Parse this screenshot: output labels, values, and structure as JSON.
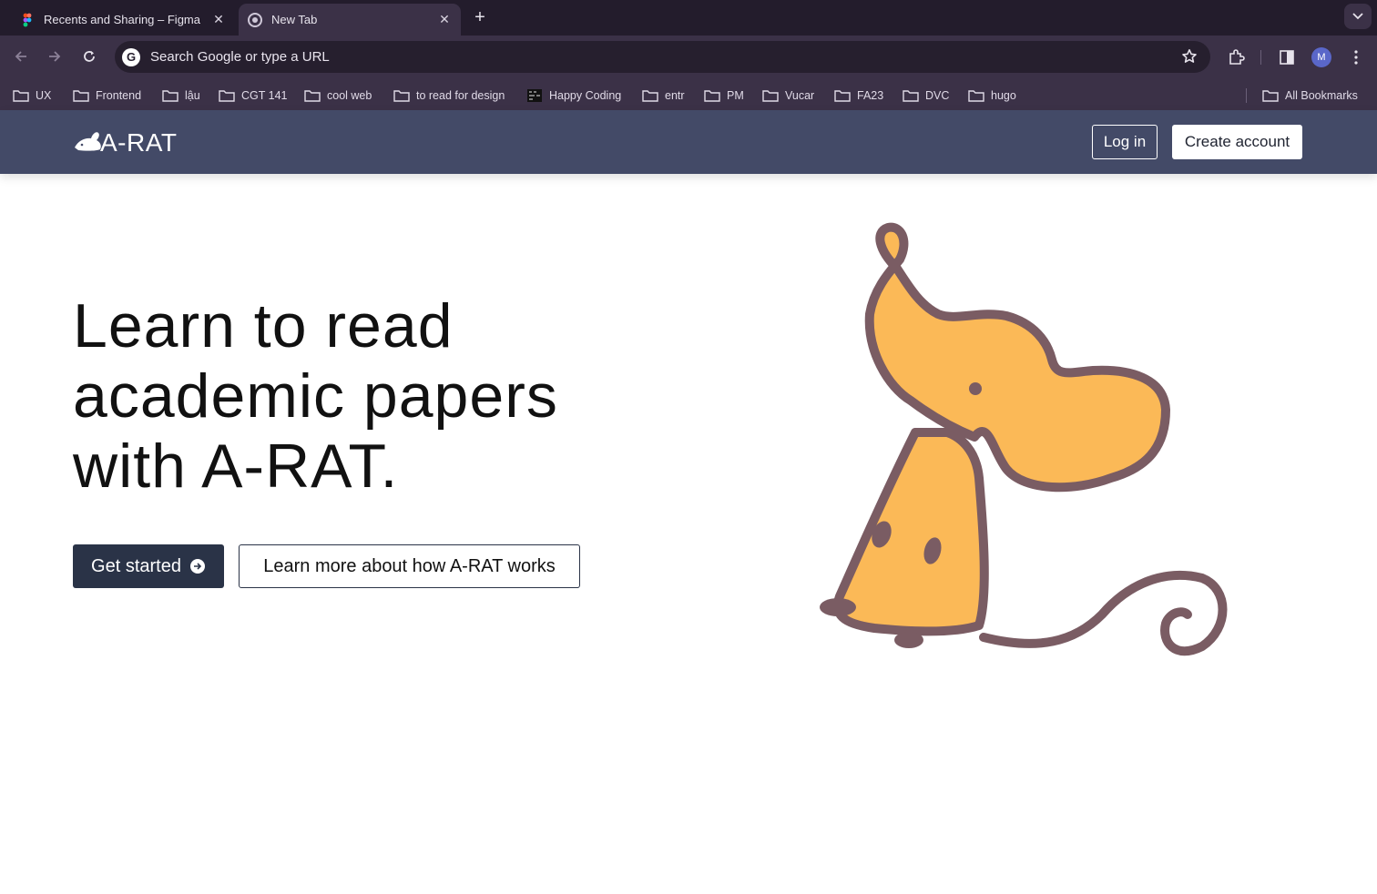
{
  "browser": {
    "tabs": [
      {
        "title": "Recents and Sharing – Figma",
        "icon": "figma-icon",
        "active": false
      },
      {
        "title": "New Tab",
        "icon": "chrome-icon",
        "active": true
      }
    ],
    "omnibox": {
      "placeholder": "Search Google or type a URL"
    },
    "profile_initial": "M",
    "bookmarks": [
      "UX",
      "Frontend",
      "lậu",
      "CGT 141",
      "cool web",
      "to read for design",
      "Happy Coding",
      "entr",
      "PM",
      "Vucar",
      "FA23",
      "DVC",
      "hugo"
    ],
    "all_bookmarks_label": "All Bookmarks"
  },
  "site": {
    "logo_text": "A-RAT",
    "login_label": "Log in",
    "create_account_label": "Create account",
    "hero": {
      "title_line1": "Learn to read",
      "title_line2": "academic papers",
      "title_line3": "with A-RAT.",
      "primary_cta": "Get started",
      "secondary_cta": "Learn more about how A-RAT works"
    },
    "colors": {
      "header_bg": "#434a67",
      "primary_btn": "#2a3347",
      "mascot_fill": "#fbb957",
      "mascot_outline": "#7a5c63"
    }
  }
}
